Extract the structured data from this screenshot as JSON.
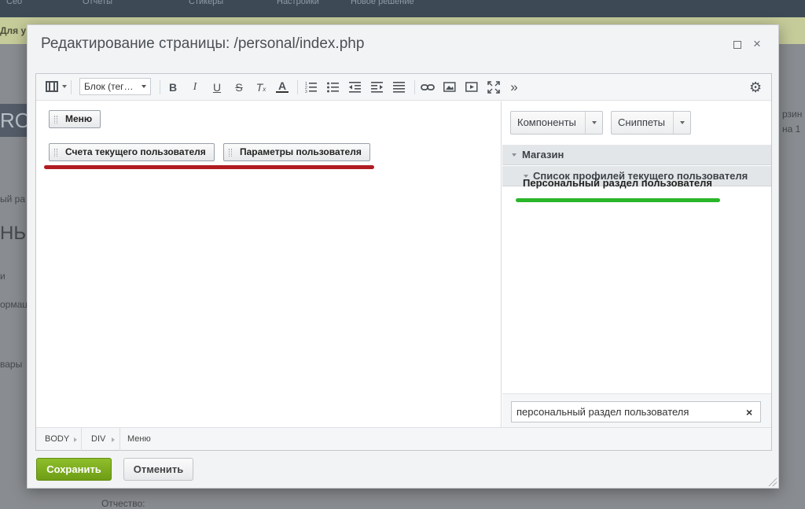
{
  "background": {
    "topbar_items": [
      "Сео",
      "Отчеты",
      "Стикеры",
      "Настройки",
      "Новое решение"
    ],
    "notice_text": "Для у",
    "block_text": "RO",
    "side_texts": [
      "ый ра",
      "НЬ",
      "и",
      "ормац",
      "вары"
    ],
    "right_texts": [
      "рзин",
      "на 1"
    ],
    "bottom_text": "Отчество:"
  },
  "dialog": {
    "title": "Редактирование страницы: /personal/index.php",
    "maximize_icon": "maximize-icon",
    "close_symbol": "×"
  },
  "toolbar": {
    "block_select_value": "Блок (тег…",
    "bold": "B",
    "italic": "I",
    "underline": "U",
    "strike": "S",
    "remove_format": "T",
    "font_color": "A",
    "more": "»",
    "icons": [
      "film-icon",
      "bold-icon",
      "italic-icon",
      "underline-icon",
      "strikethrough-icon",
      "remove-format-icon",
      "font-color-icon",
      "ordered-list-icon",
      "unordered-list-icon",
      "outdent-icon",
      "indent-icon",
      "align-icon",
      "link-icon",
      "image-icon",
      "video-icon",
      "fullscreen-icon",
      "more-icon",
      "settings-icon"
    ]
  },
  "editor": {
    "menu_block": "Меню",
    "account_block": "Счета текущего пользователя",
    "params_block": "Параметры пользователя",
    "underline_color": "#b01c22"
  },
  "right_panel": {
    "components_button": "Компоненты",
    "snippets_button": "Сниппеты",
    "tree_level1": "Магазин",
    "tree_level2": "Список профилей текущего пользователя",
    "tree_leaf": "Персональный раздел пользователя",
    "underline_color": "#2ab52a",
    "search_value": "персональный раздел пользователя",
    "search_clear": "×"
  },
  "statusbar": {
    "crumbs": [
      "BODY",
      "DIV",
      "Меню"
    ]
  },
  "actions": {
    "save": "Сохранить",
    "cancel": "Отменить"
  }
}
